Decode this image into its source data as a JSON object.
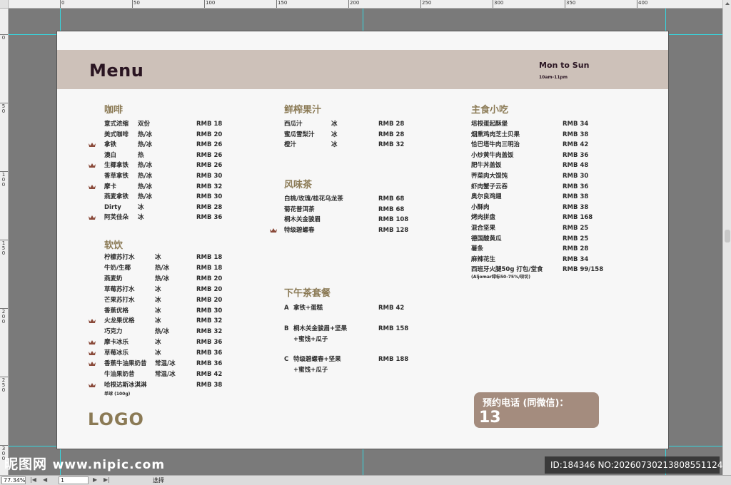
{
  "ruler": {
    "top_labels": [
      "0",
      "50",
      "100",
      "150",
      "200",
      "250",
      "300",
      "350",
      "400"
    ],
    "left_labels": [
      "0",
      "50",
      "100",
      "150",
      "200",
      "250",
      "300"
    ]
  },
  "header": {
    "title": "Menu",
    "days": "Mon to Sun",
    "hours": "10am-11pm"
  },
  "sections": {
    "coffee": "咖啡",
    "soft_drinks": "软饮",
    "juice": "鲜榨果汁",
    "tea": "风味茶",
    "afternoon": "下午茶套餐",
    "food": "主食小吃"
  },
  "coffee_items": [
    {
      "name": "意式浓缩",
      "opt": "双份",
      "price": "RMB 18",
      "crown": false
    },
    {
      "name": "美式咖啡",
      "opt": "热/冰",
      "price": "RMB 20",
      "crown": false
    },
    {
      "name": "拿铁",
      "opt": "热/冰",
      "price": "RMB 26",
      "crown": true
    },
    {
      "name": "澳白",
      "opt": "热",
      "price": "RMB 26",
      "crown": false
    },
    {
      "name": "生椰拿铁",
      "opt": "热/冰",
      "price": "RMB 26",
      "crown": true
    },
    {
      "name": "香草拿铁",
      "opt": "热/冰",
      "price": "RMB 30",
      "crown": false
    },
    {
      "name": "摩卡",
      "opt": "热/冰",
      "price": "RMB 32",
      "crown": true
    },
    {
      "name": "燕麦拿铁",
      "opt": "热/冰",
      "price": "RMB 30",
      "crown": false
    },
    {
      "name": "Dirty",
      "opt": "冰",
      "price": "RMB 28",
      "crown": false
    },
    {
      "name": "阿芙佳朵",
      "opt": "冰",
      "price": "RMB 36",
      "crown": true
    }
  ],
  "soft_items": [
    {
      "name": "柠檬苏打水",
      "opt": "冰",
      "price": "RMB 18",
      "crown": false
    },
    {
      "name": "牛奶/生椰",
      "opt": "热/冰",
      "price": "RMB 18",
      "crown": false
    },
    {
      "name": "燕麦奶",
      "opt": "热/冰",
      "price": "RMB 20",
      "crown": false
    },
    {
      "name": "草莓苏打水",
      "opt": "冰",
      "price": "RMB 20",
      "crown": false
    },
    {
      "name": "芒果苏打水",
      "opt": "冰",
      "price": "RMB 20",
      "crown": false
    },
    {
      "name": "香蕉优格",
      "opt": "冰",
      "price": "RMB 30",
      "crown": false
    },
    {
      "name": "火龙果优格",
      "opt": "冰",
      "price": "RMB 32",
      "crown": true
    },
    {
      "name": "巧克力",
      "opt": "热/冰",
      "price": "RMB 32",
      "crown": false
    },
    {
      "name": "摩卡冰乐",
      "opt": "冰",
      "price": "RMB 36",
      "crown": true
    },
    {
      "name": "草莓冰乐",
      "opt": "冰",
      "price": "RMB 36",
      "crown": true
    },
    {
      "name": "香蕉牛油果奶昔",
      "opt": "常温/冰",
      "price": "RMB 36",
      "crown": true
    },
    {
      "name": "牛油果奶昔",
      "opt": "常温/冰",
      "price": "RMB 42",
      "crown": false
    },
    {
      "name": "哈根达斯冰淇淋",
      "opt": "",
      "price": "RMB 38",
      "crown": true
    }
  ],
  "soft_note": "单球 (100g)",
  "juice_items": [
    {
      "name": "西瓜汁",
      "opt": "冰",
      "price": "RMB 28"
    },
    {
      "name": "蜜瓜雪梨汁",
      "opt": "冰",
      "price": "RMB 28"
    },
    {
      "name": "橙汁",
      "opt": "冰",
      "price": "RMB 32"
    }
  ],
  "tea_items": [
    {
      "name": "白桃/玫瑰/桂花乌龙茶",
      "price": "RMB 68",
      "crown": false
    },
    {
      "name": "菊花普洱茶",
      "price": "RMB 68",
      "crown": false
    },
    {
      "name": "桐木关金骏眉",
      "price": "RMB 108",
      "crown": false
    },
    {
      "name": "特级碧螺春",
      "price": "RMB 128",
      "crown": true
    }
  ],
  "afternoon_sets": [
    {
      "letter": "A",
      "line1": "拿铁+蛋糕",
      "line2": "",
      "price": "RMB 42"
    },
    {
      "letter": "B",
      "line1": "桐木关金骏眉+坚果",
      "line2": "+蜜饯+瓜子",
      "price": "RMB 158"
    },
    {
      "letter": "C",
      "line1": "特级碧螺春+坚果",
      "line2": "+蜜饯+瓜子",
      "price": "RMB 188"
    }
  ],
  "food_items": [
    {
      "name": "培根蛋起酥堡",
      "price": "RMB  34"
    },
    {
      "name": "烟熏鸡肉芝士贝果",
      "price": "RMB  38"
    },
    {
      "name": "恰巴塔牛肉三明治",
      "price": "RMB  42"
    },
    {
      "name": "小炒黄牛肉盖饭",
      "price": "RMB  36"
    },
    {
      "name": "肥牛丼盖饭",
      "price": "RMB  48"
    },
    {
      "name": "荠菜肉大馄饨",
      "price": "RMB  30"
    },
    {
      "name": "虾肉蟹子云吞",
      "price": "RMB  36"
    },
    {
      "name": "奥尔良鸡翅",
      "price": "RMB  38"
    },
    {
      "name": "小酥肉",
      "price": "RMB  38"
    },
    {
      "name": "烤肉拼盘",
      "price": "RMB  168"
    },
    {
      "name": "混合坚果",
      "price": "RMB  25"
    },
    {
      "name": "德国酸黄瓜",
      "price": "RMB  25"
    },
    {
      "name": "薯条",
      "price": "RMB  28"
    },
    {
      "name": "麻辣花生",
      "price": "RMB  34"
    },
    {
      "name": "西班牙火腿50g 打包/堂食",
      "price": "RMB 99/158"
    }
  ],
  "food_note": "(Aljomar绿标50-75%/现切)",
  "logo": "LOGO",
  "phone": {
    "label": "预约电话 (同微信)：",
    "number": "13"
  },
  "statusbar": {
    "zoom": "77.34%",
    "page": "1",
    "tool": "选择"
  },
  "watermark": {
    "brand": "昵图网",
    "site": "www.nipic.com",
    "id": "ID:184346 NO:20260730213808551124"
  },
  "colors": {
    "header_band": "#cdc1b9",
    "section_heading": "#8b7a55",
    "phone_box": "#a48c7e",
    "crown": "#8a4a3a",
    "guide": "#36d7e0"
  }
}
